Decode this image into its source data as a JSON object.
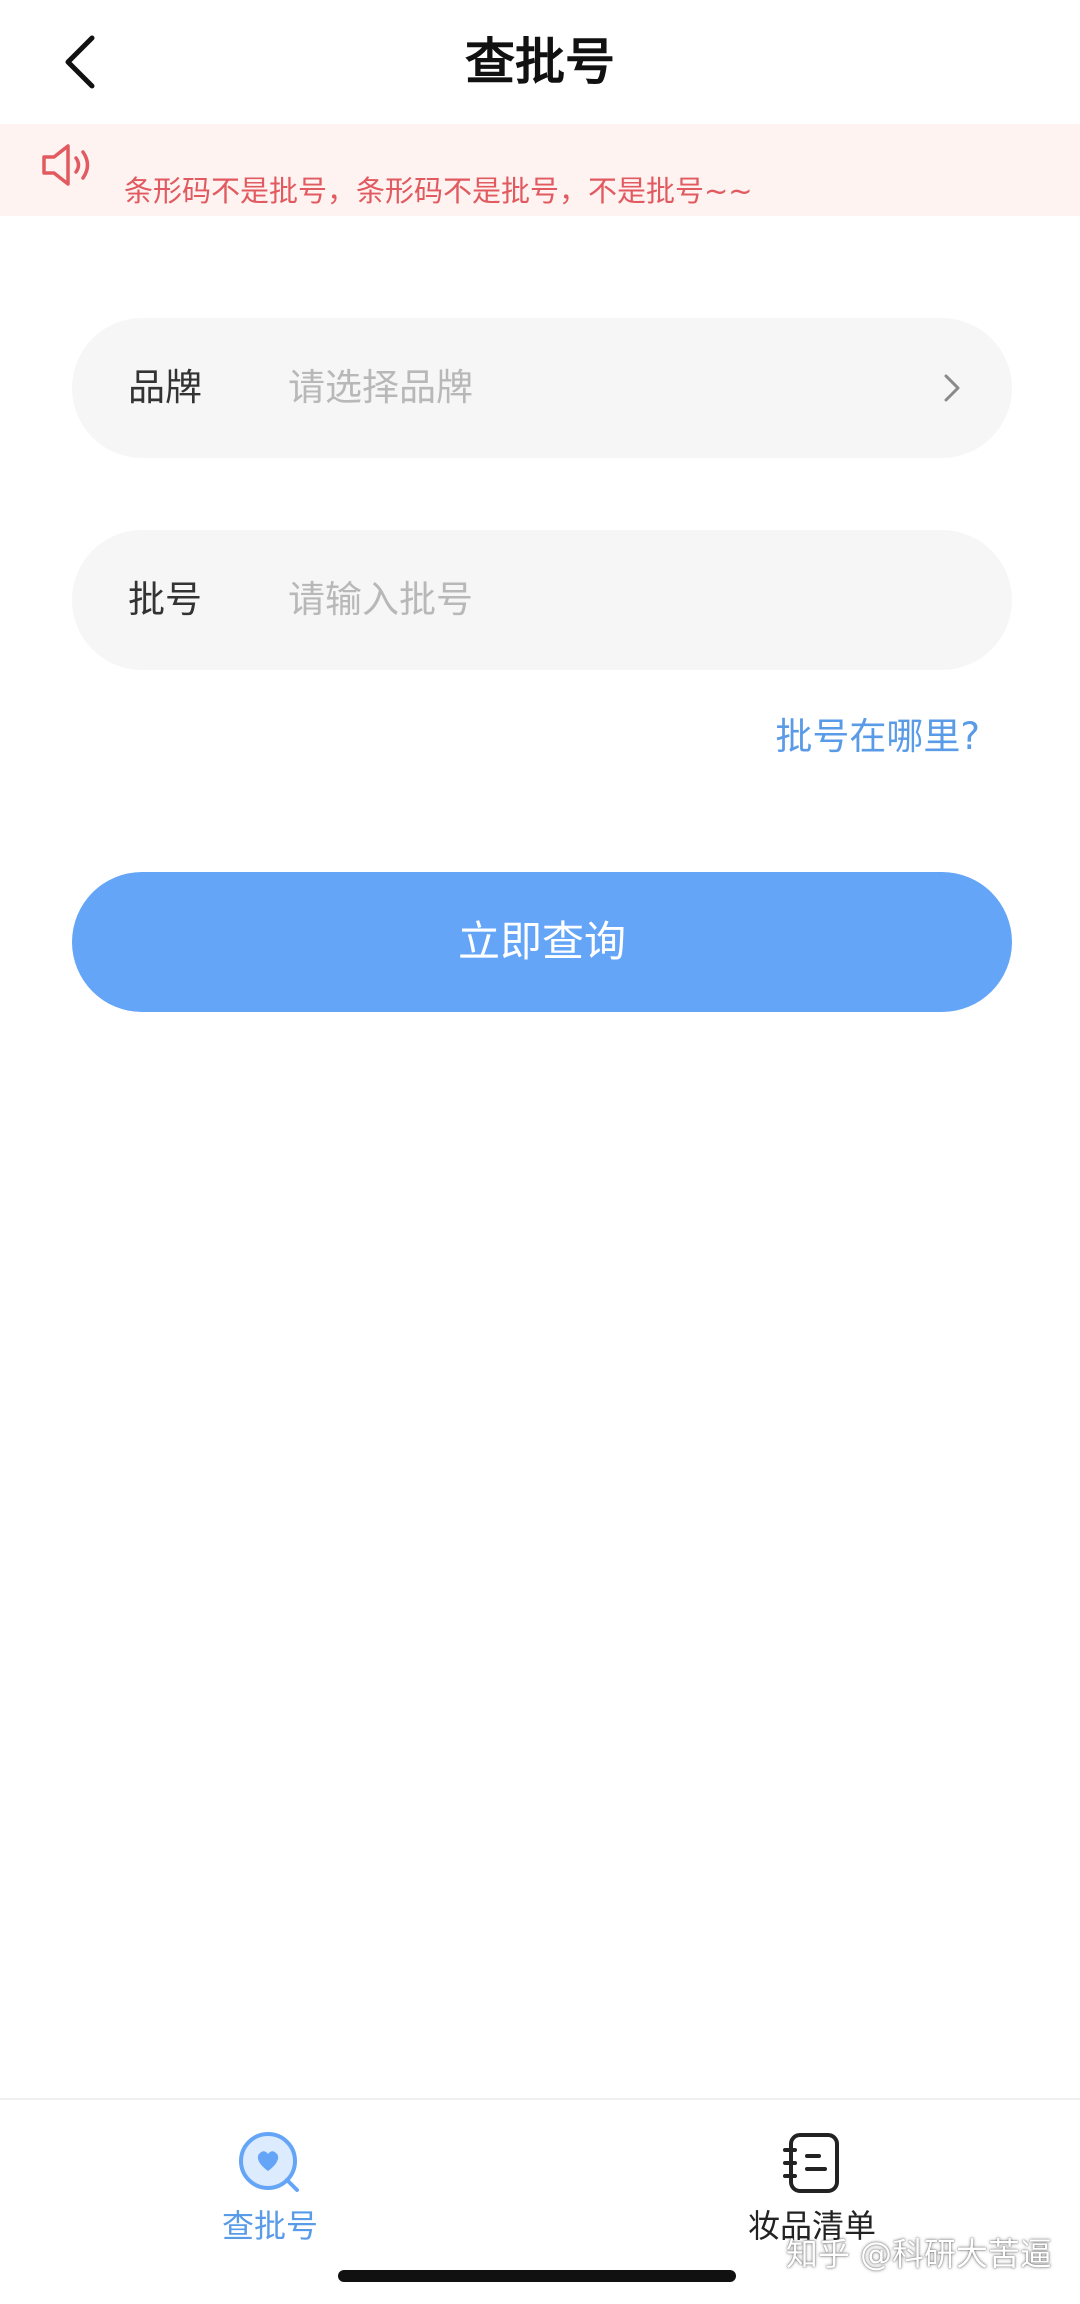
{
  "header": {
    "title": "查批号",
    "back_icon": "chevron-left-icon"
  },
  "notice": {
    "icon": "speaker-icon",
    "text": "条形码不是批号，条形码不是批号，不是批号~~",
    "color": "#e05a5f",
    "background": "#fff3f2"
  },
  "form": {
    "brand": {
      "label": "品牌",
      "placeholder": "请选择品牌",
      "icon": "chevron-right-icon"
    },
    "batch": {
      "label": "批号",
      "placeholder": "请输入批号"
    },
    "help_link": "批号在哪里?",
    "submit_label": "立即查询",
    "accent": "#64a5f8"
  },
  "tabbar": {
    "tabs": [
      {
        "label": "查批号",
        "icon": "search-heart-icon",
        "active": true
      },
      {
        "label": "妆品清单",
        "icon": "notebook-icon",
        "active": false
      }
    ]
  },
  "watermark": "知乎 @科研大苦逼"
}
